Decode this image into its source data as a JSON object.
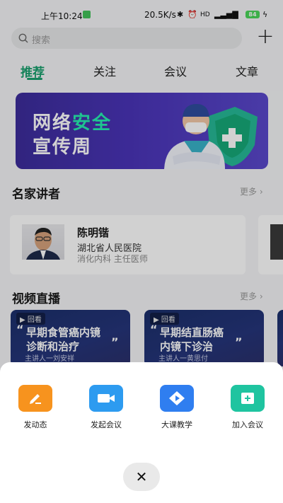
{
  "status_bar": {
    "time": "上午10:24",
    "network_speed": "20.5K/s",
    "battery": "84"
  },
  "search": {
    "placeholder": "搜索"
  },
  "tabs": [
    {
      "label": "推荐",
      "active": true
    },
    {
      "label": "关注",
      "active": false
    },
    {
      "label": "会议",
      "active": false
    },
    {
      "label": "文章",
      "active": false
    }
  ],
  "banner": {
    "line1_part1": "网络",
    "line1_part2": "安全",
    "line2": "宣传周"
  },
  "lecturers": {
    "title": "名家讲者",
    "more": "更多 ›",
    "items": [
      {
        "name": "陈明锴",
        "hospital": "湖北省人民医院",
        "dept_title": "消化内科 主任医师"
      }
    ]
  },
  "live": {
    "title": "视频直播",
    "more": "更多 ›",
    "items": [
      {
        "tag": "回看",
        "title_line1": "早期食管癌内镜",
        "title_line2": "诊断和治疗",
        "speaker": "主讲人一刘安祥"
      },
      {
        "tag": "回看",
        "title_line1": "早期结直肠癌",
        "title_line2": "内镜下诊治",
        "speaker": "主讲人一黄思付"
      }
    ]
  },
  "action_sheet": {
    "items": [
      {
        "label": "发动态",
        "icon": "edit-icon",
        "color": "#f7931e"
      },
      {
        "label": "发起会议",
        "icon": "video-camera-icon",
        "color": "#2d9bf0"
      },
      {
        "label": "大课教学",
        "icon": "play-icon",
        "color": "#2f7ef0"
      },
      {
        "label": "加入会议",
        "icon": "add-box-icon",
        "color": "#1fc4a0"
      }
    ],
    "close_icon": "close-icon"
  },
  "colors": {
    "accent": "#1aa06e"
  }
}
